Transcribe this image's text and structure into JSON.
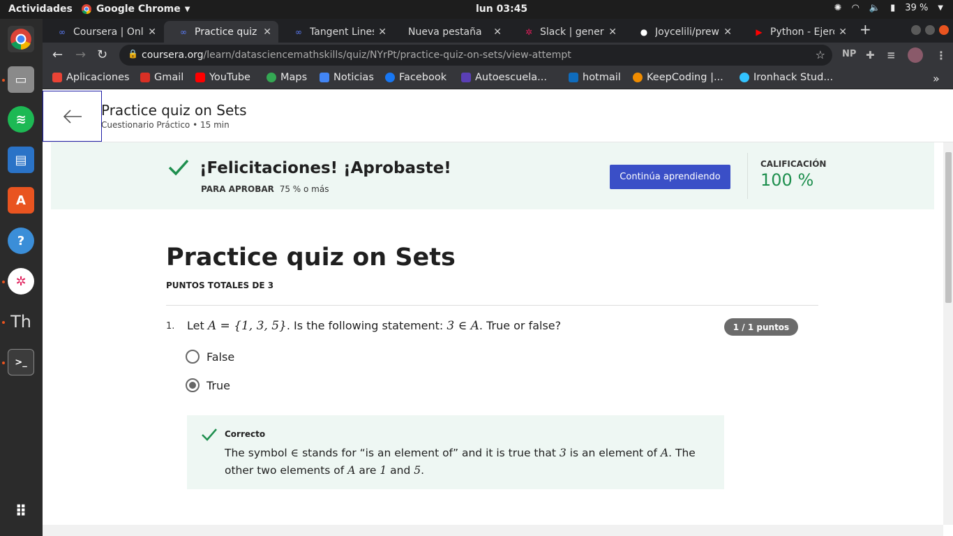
{
  "system": {
    "activities": "Actividades",
    "app_name": "Google Chrome",
    "clock": "lun 03:45",
    "battery": "39 %"
  },
  "tabs": [
    {
      "title": "Coursera | Onl",
      "icon": "coursera-icon",
      "color": "#5b7cf7"
    },
    {
      "title": "Practice quiz o",
      "icon": "coursera-icon",
      "color": "#5b7cf7"
    },
    {
      "title": "Tangent Lines",
      "icon": "coursera-icon",
      "color": "#5b7cf7"
    },
    {
      "title": "Nueva pestaña",
      "icon": "",
      "color": ""
    },
    {
      "title": "Slack | general",
      "icon": "slack-icon",
      "color": "#e01e5a"
    },
    {
      "title": "Joycelili/prewo",
      "icon": "github-icon",
      "color": "#fff"
    },
    {
      "title": "Python - Ejerci",
      "icon": "youtube-icon",
      "color": "#ff0000"
    }
  ],
  "address": {
    "host": "coursera.org",
    "path": "/learn/datasciencemathskills/quiz/NYrPt/practice-quiz-on-sets/view-attempt"
  },
  "toolbar_ext": "NP",
  "bookmarks": [
    {
      "label": "Aplicaciones",
      "color": "#ea4335"
    },
    {
      "label": "Gmail",
      "color": "#d93025"
    },
    {
      "label": "YouTube",
      "color": "#ff0000"
    },
    {
      "label": "Maps",
      "color": "#34a853"
    },
    {
      "label": "Noticias",
      "color": "#4285f4"
    },
    {
      "label": "Facebook",
      "color": "#1877f2"
    },
    {
      "label": "Autoescuela...",
      "color": "#5a3fb5"
    },
    {
      "label": "hotmail",
      "color": "#0f6cbd"
    },
    {
      "label": "KeepCoding |...",
      "color": "#f08c00"
    },
    {
      "label": "Ironhack Stud...",
      "color": "#32c3ff"
    }
  ],
  "header": {
    "title": "Practice quiz on Sets",
    "subtitle": "Cuestionario Práctico • 15 min"
  },
  "banner": {
    "message": "¡Felicitaciones! ¡Aprobaste!",
    "pass_label": "PARA APROBAR",
    "pass_value": "75 % o más",
    "continue_label": "Continúa aprendiendo",
    "grade_label": "CALIFICACIÓN",
    "grade_value": "100 %"
  },
  "quiz": {
    "title": "Practice quiz on Sets",
    "total_points": "PUNTOS TOTALES DE 3",
    "question": {
      "number": "1.",
      "prefix": "Let",
      "set": "A = {1, 3, 5}",
      "middle": ". Is the following statement:",
      "statement": "3 ∈ A",
      "suffix": ". True or false?",
      "score": "1 / 1 puntos",
      "options": [
        {
          "label": "False",
          "selected": false
        },
        {
          "label": "True",
          "selected": true
        }
      ],
      "feedback": {
        "title": "Correcto",
        "t1": "The symbol",
        "sym": "∈",
        "t2": "stands for “is an element of” and it is true that",
        "three": "3",
        "t3": "is an element of",
        "a1": "A",
        "t4": ". The other two elements of",
        "a2": "A",
        "t5": "are",
        "one": "1",
        "t6": "and",
        "five": "5",
        "t7": "."
      }
    }
  }
}
